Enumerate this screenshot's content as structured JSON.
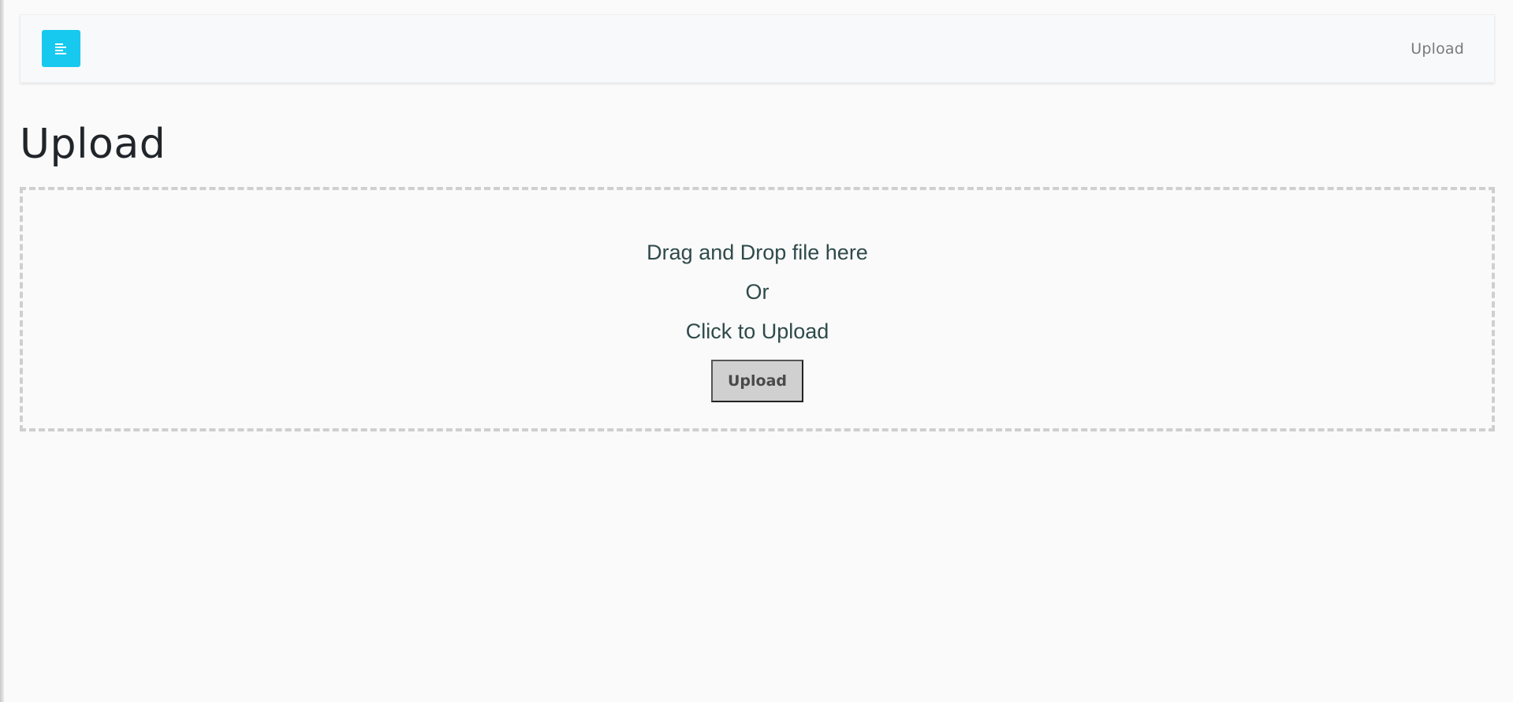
{
  "navbar": {
    "toggle_icon": "menu-align-left-icon",
    "accent_color": "#17c9ef",
    "link_label": "Upload"
  },
  "main": {
    "title": "Upload"
  },
  "dropzone": {
    "line1": "Drag and Drop file here",
    "line2": "Or",
    "line3": "Click to Upload",
    "button_label": "Upload"
  }
}
